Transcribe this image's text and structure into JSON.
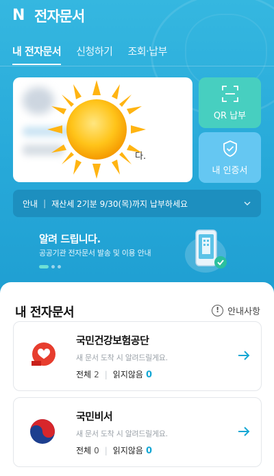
{
  "header": {
    "logo": "N",
    "title": "전자문서"
  },
  "tabs": [
    {
      "label": "내 전자문서",
      "active": true
    },
    {
      "label": "신청하기",
      "active": false
    },
    {
      "label": "조회·납부",
      "active": false
    }
  ],
  "doc_card": {
    "tail_text": "다."
  },
  "side_buttons": {
    "qr": {
      "label": "QR 납부",
      "icon": "qr-scan-icon"
    },
    "cert": {
      "label": "내 인증서",
      "icon": "shield-check-icon"
    }
  },
  "notice": {
    "tag": "안내",
    "text": "재산세 2기분 9/30(목)까지 납부하세요"
  },
  "banner": {
    "title": "알려 드립니다.",
    "subtitle": "공공기관 전자문서 발송 및 이용 안내",
    "current_slide": 1,
    "total_slides": 3
  },
  "section": {
    "title": "내 전자문서",
    "info_label": "안내사항"
  },
  "orgs": [
    {
      "name": "국민건강보험공단",
      "desc": "새 문서 도착 시 알려드릴게요.",
      "total_label": "전체",
      "total": "2",
      "unread_label": "읽지않음",
      "unread": "0",
      "icon": "nhis-logo-icon"
    },
    {
      "name": "국민비서",
      "desc": "새 문서 도착 시 알려드릴게요.",
      "total_label": "전체",
      "total": "0",
      "unread_label": "읽지않음",
      "unread": "0",
      "icon": "taegeuk-icon"
    }
  ],
  "colors": {
    "accent": "#15a7d4",
    "header_bg": "#2aaddb",
    "qr_button": "#47cfc0",
    "cert_button": "#65c7f2"
  }
}
